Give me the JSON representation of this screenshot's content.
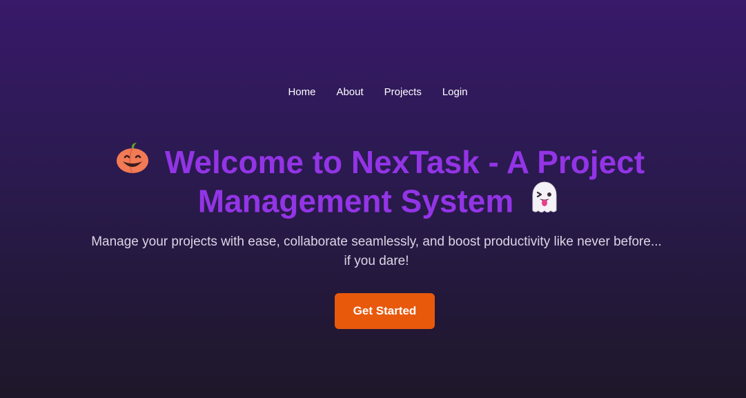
{
  "nav": {
    "items": [
      {
        "label": "Home"
      },
      {
        "label": "About"
      },
      {
        "label": "Projects"
      },
      {
        "label": "Login"
      }
    ]
  },
  "hero": {
    "title": "Welcome to NexTask - A Project Management System",
    "subtitle": "Manage your projects with ease, collaborate seamlessly, and boost productivity like never before... if you dare!",
    "cta_label": "Get Started",
    "icons": [
      "pumpkin-icon",
      "ghost-icon"
    ]
  },
  "colors": {
    "background_top": "#38196a",
    "background_bottom": "#1e1729",
    "title": "#9334e6",
    "cta": "#e8590c",
    "nav_text": "#ffffff",
    "subtitle_text": "#dcd6e6"
  }
}
